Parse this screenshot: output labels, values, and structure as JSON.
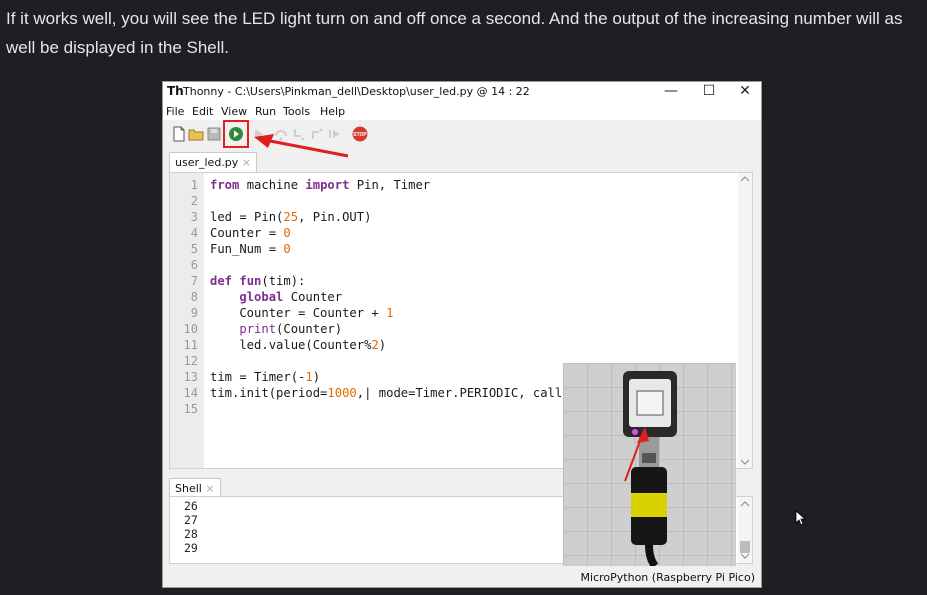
{
  "article": {
    "paragraph": "If it works well, you will see the LED light turn on and off once a second. And the output of the increasing number will as well be displayed in the Shell."
  },
  "window": {
    "title": "Thonny  -  C:\\Users\\Pinkman_dell\\Desktop\\user_led.py  @  14 : 22",
    "minimize": "—",
    "maximize": "☐",
    "close": "✕"
  },
  "menu": [
    "File",
    "Edit",
    "View",
    "Run",
    "Tools",
    "Help"
  ],
  "toolbar": {
    "icons": [
      "new-file-icon",
      "open-file-icon",
      "save-icon",
      "run-icon",
      "debug-icon",
      "step-over-icon",
      "step-into-icon",
      "step-out-icon",
      "resume-icon",
      "stop-icon"
    ],
    "stop_label": "STOP"
  },
  "editor": {
    "tab_label": "user_led.py",
    "tab_close": "×",
    "line_numbers": [
      "1",
      "2",
      "3",
      "4",
      "5",
      "6",
      "7",
      "8",
      "9",
      "10",
      "11",
      "12",
      "13",
      "14",
      "15"
    ]
  },
  "shell": {
    "tab_label": "Shell",
    "tab_close": "×",
    "lines": [
      "26",
      "27",
      "28",
      "29"
    ]
  },
  "status": {
    "interpreter": "MicroPython (Raspberry Pi Pico)"
  },
  "colors": {
    "page_bg": "#1e1f22",
    "highlight": "#e02020",
    "keyword": "#7b2f8f",
    "number": "#e06b00",
    "run_green": "#2e8b3a"
  }
}
